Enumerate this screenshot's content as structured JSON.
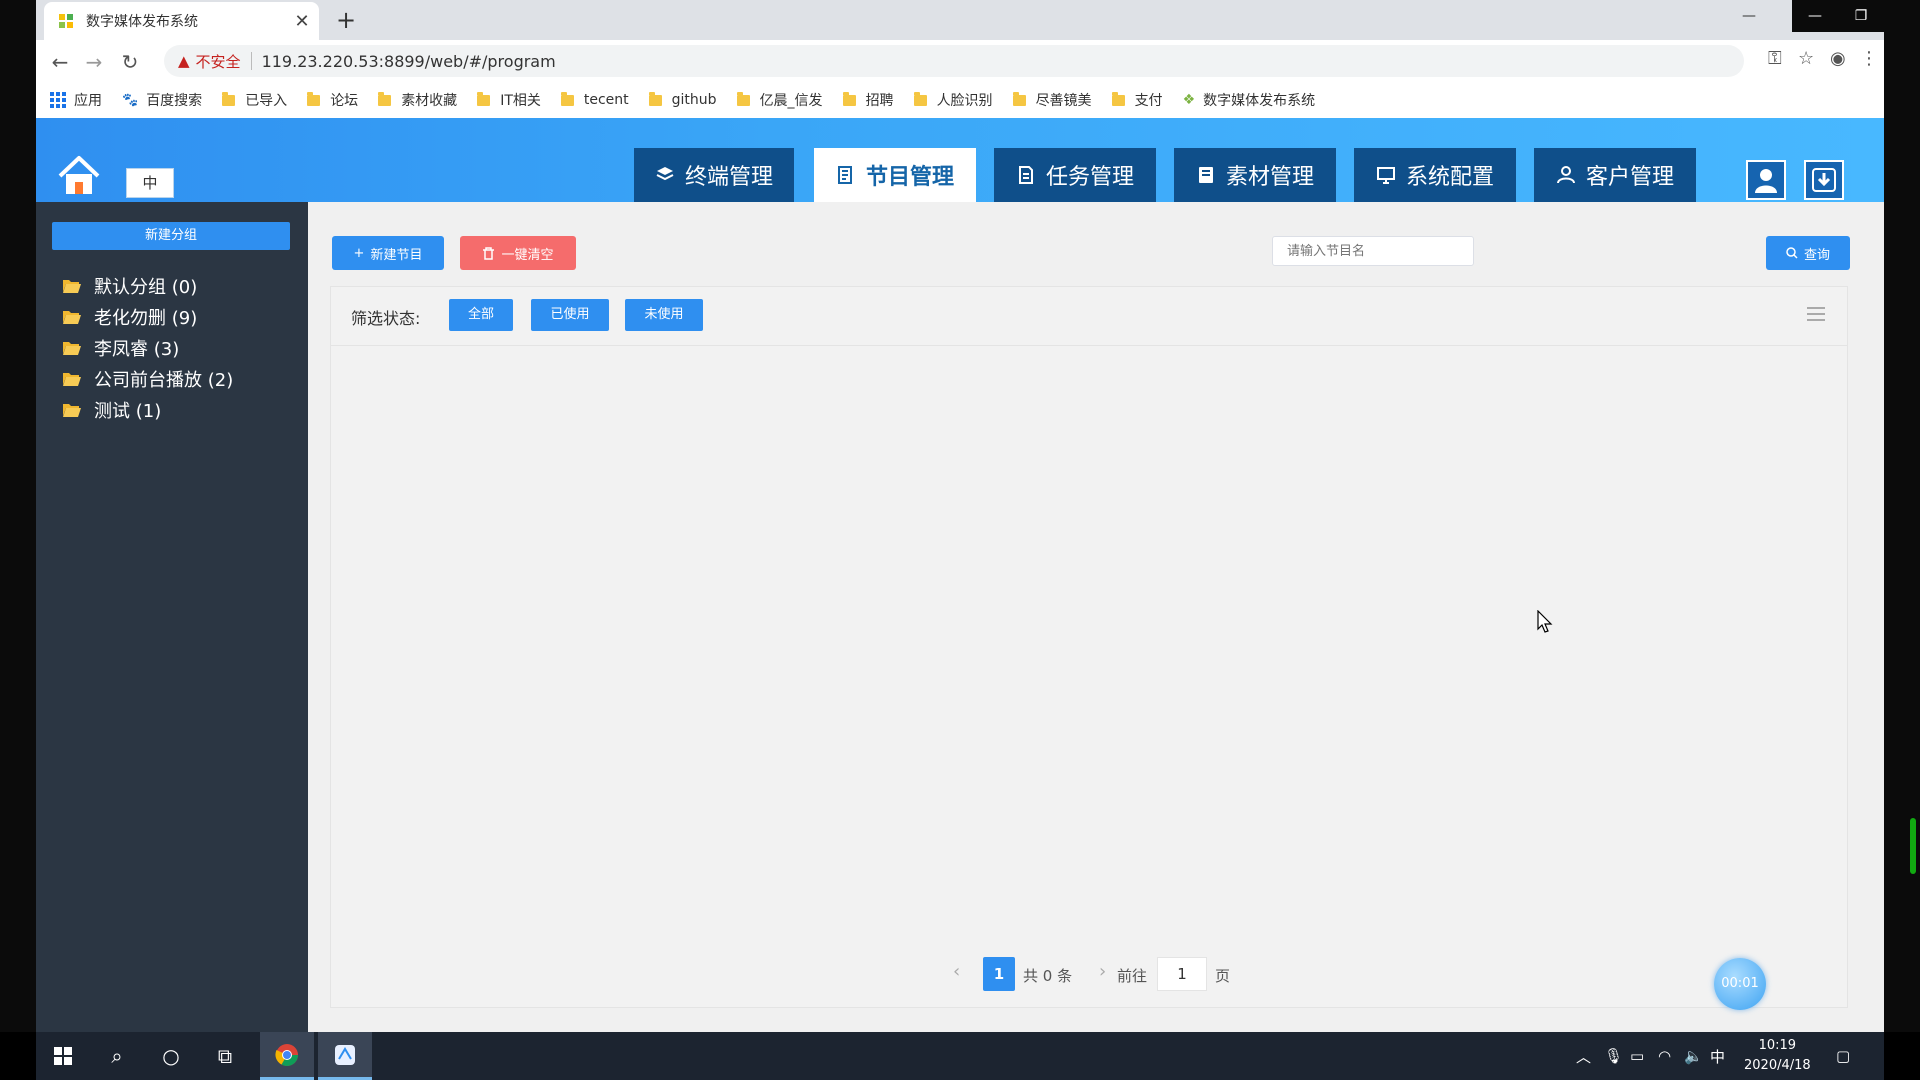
{
  "browser": {
    "tab_title": "数字媒体发布系统",
    "insecure_label": "不安全",
    "url": "119.23.220.53:8899/web/#/program"
  },
  "bookmarks": [
    {
      "label": "应用",
      "type": "apps"
    },
    {
      "label": "百度搜索",
      "type": "baidu"
    },
    {
      "label": "已导入",
      "type": "folder"
    },
    {
      "label": "论坛",
      "type": "folder"
    },
    {
      "label": "素材收藏",
      "type": "folder"
    },
    {
      "label": "IT相关",
      "type": "folder"
    },
    {
      "label": "tecent",
      "type": "folder"
    },
    {
      "label": "github",
      "type": "folder"
    },
    {
      "label": "亿晨_信发",
      "type": "folder"
    },
    {
      "label": "招聘",
      "type": "folder"
    },
    {
      "label": "人脸识别",
      "type": "folder"
    },
    {
      "label": "尽善镜美",
      "type": "folder"
    },
    {
      "label": "支付",
      "type": "folder"
    },
    {
      "label": "数字媒体发布系统",
      "type": "site"
    }
  ],
  "header": {
    "lang": "中",
    "nav": [
      {
        "label": "终端管理",
        "icon": "layers-icon"
      },
      {
        "label": "节目管理",
        "icon": "program-icon",
        "active": true
      },
      {
        "label": "任务管理",
        "icon": "task-icon"
      },
      {
        "label": "素材管理",
        "icon": "material-icon"
      },
      {
        "label": "系统配置",
        "icon": "monitor-icon"
      },
      {
        "label": "客户管理",
        "icon": "user-icon"
      }
    ]
  },
  "sidebar": {
    "new_group_label": "新建分组",
    "groups": [
      {
        "label": "默认分组 (0)"
      },
      {
        "label": "老化勿删 (9)"
      },
      {
        "label": "李凤睿 (3)"
      },
      {
        "label": "公司前台播放 (2)"
      },
      {
        "label": "测试 (1)"
      }
    ]
  },
  "toolbar": {
    "new_program_label": "新建节目",
    "clear_all_label": "一键清空",
    "search_placeholder": "请输入节目名",
    "query_label": "查询"
  },
  "filter": {
    "label": "筛选状态:",
    "options": [
      "全部",
      "已使用",
      "未使用"
    ]
  },
  "pager": {
    "current_page": "1",
    "total_text": "共 0 条",
    "goto_label": "前往",
    "goto_value": "1",
    "page_suffix": "页"
  },
  "timer": "00:01",
  "taskbar": {
    "time": "10:19",
    "date": "2020/4/18",
    "ime": "中"
  },
  "colors": {
    "primary": "#2f8ff0",
    "danger": "#f56c6c",
    "nav_dark": "#0f4f8a",
    "sidebar": "#2b3643"
  }
}
